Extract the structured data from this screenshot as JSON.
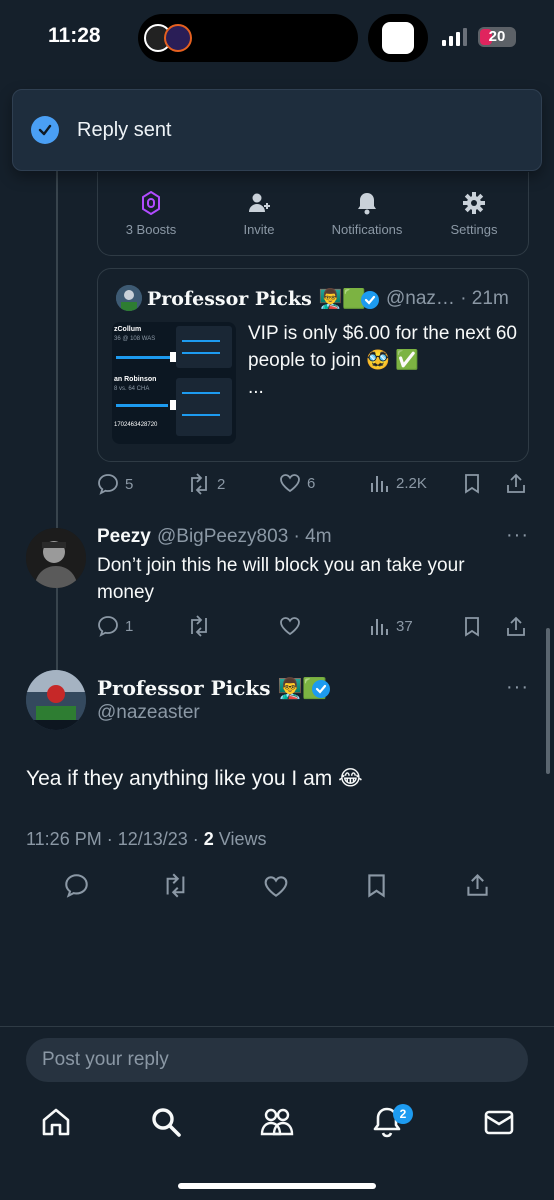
{
  "status_bar": {
    "time": "11:28",
    "battery": "20"
  },
  "toast": {
    "text": "Reply sent"
  },
  "creator_bar": {
    "items": [
      {
        "label": "3 Boosts",
        "icon": "boost-icon"
      },
      {
        "label": "Invite",
        "icon": "person-add-icon"
      },
      {
        "label": "Notifications",
        "icon": "bell-icon"
      },
      {
        "label": "Settings",
        "icon": "gear-icon"
      }
    ]
  },
  "quoted_tweet": {
    "name": "Professor Picks",
    "emoji": "👨‍🏫🟩",
    "handle": "@naz… · 21m",
    "text": "VIP is only $6.00 for the next 60 people to join 🥸 ✅",
    "more": "...",
    "image_lines": [
      "zCollum",
      "36 @ 108 WAS",
      "an Robinson",
      "8 vs. 64 CHA",
      "1702463428720"
    ],
    "stats": {
      "replies": "5",
      "retweets": "2",
      "likes": "6",
      "views": "2.2K"
    }
  },
  "reply": {
    "name": "Peezy",
    "handle": "@BigPeezy803 · 4m",
    "text": "Don’t join this he will block you an take your money",
    "stats": {
      "replies": "1",
      "views": "37"
    },
    "more": "···"
  },
  "main_tweet": {
    "name": "Professor Picks",
    "emoji": "👨‍🏫🟩",
    "handle": "@nazeaster",
    "text": "Yea if they anything like you I am 😂",
    "time": "11:26 PM · 12/13/23 · ",
    "views_count": "2",
    "views_label": " Views",
    "more": "···"
  },
  "composer": {
    "placeholder": "Post your reply"
  },
  "tab_bar": {
    "notification_badge": "2"
  },
  "colors": {
    "background": "#15202b",
    "accent": "#1d9bf0",
    "muted": "#8b98a5",
    "verified": "#1d9bf0",
    "boost": "#b14bff"
  }
}
